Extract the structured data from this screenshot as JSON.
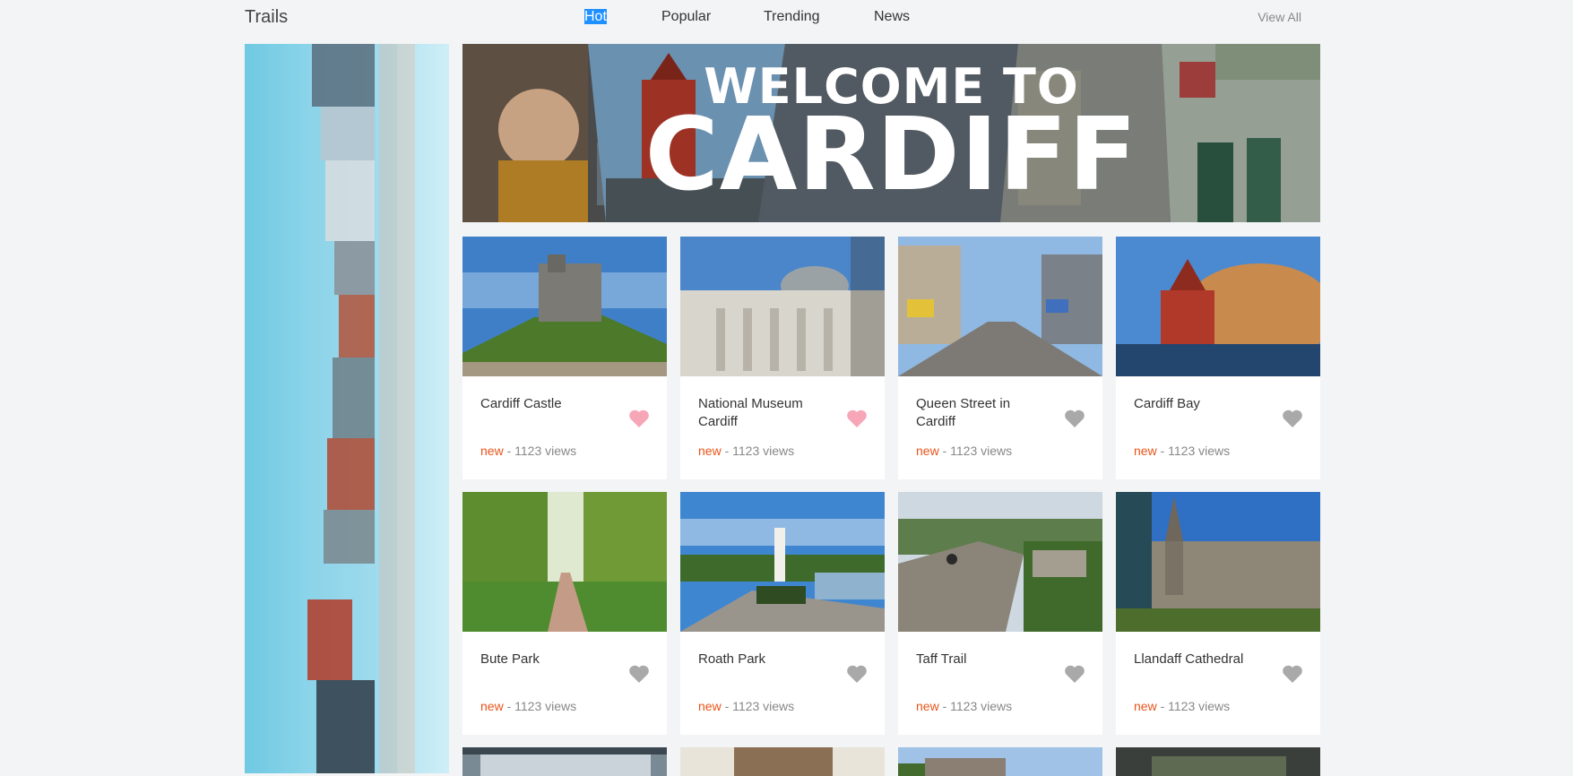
{
  "header": {
    "brand": "Trails",
    "tabs": [
      {
        "label": "Hot",
        "active": true
      },
      {
        "label": "Popular",
        "active": false
      },
      {
        "label": "Trending",
        "active": false
      },
      {
        "label": "News",
        "active": false
      }
    ],
    "view_all": "View All"
  },
  "hero": {
    "line1": "WELCOME TO",
    "line2": "CARDIFF"
  },
  "cards": [
    {
      "title": "Cardiff Castle",
      "tag": "new",
      "views": " - 1123 views",
      "liked": true
    },
    {
      "title": "National Museum Cardiff",
      "tag": "new",
      "views": " - 1123 views",
      "liked": true
    },
    {
      "title": "Queen Street in Cardiff",
      "tag": "new",
      "views": " - 1123 views",
      "liked": false
    },
    {
      "title": "Cardiff Bay",
      "tag": "new",
      "views": " - 1123 views",
      "liked": false
    },
    {
      "title": "Bute Park",
      "tag": "new",
      "views": " - 1123 views",
      "liked": false
    },
    {
      "title": "Roath Park",
      "tag": "new",
      "views": " - 1123 views",
      "liked": false
    },
    {
      "title": "Taff Trail",
      "tag": "new",
      "views": " - 1123 views",
      "liked": false
    },
    {
      "title": "Llandaff Cathedral",
      "tag": "new",
      "views": " - 1123 views",
      "liked": false
    }
  ],
  "colors": {
    "liked_heart": "#f7a6b8",
    "unliked_heart": "#a9a9a9",
    "tag": "#e8541a",
    "active_tab_bg": "#1e90ff"
  },
  "icons": {
    "heart": "heart-icon"
  }
}
